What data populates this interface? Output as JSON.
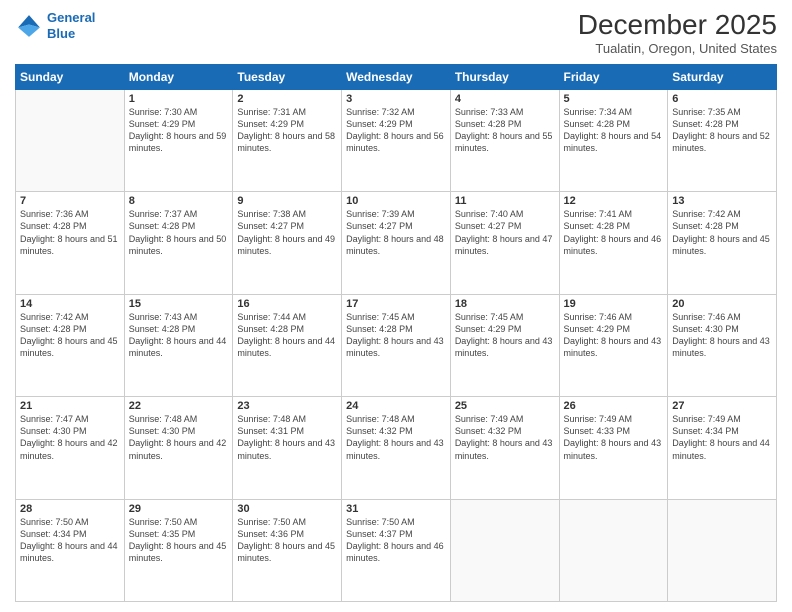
{
  "logo": {
    "line1": "General",
    "line2": "Blue"
  },
  "title": "December 2025",
  "subtitle": "Tualatin, Oregon, United States",
  "days_of_week": [
    "Sunday",
    "Monday",
    "Tuesday",
    "Wednesday",
    "Thursday",
    "Friday",
    "Saturday"
  ],
  "weeks": [
    [
      {
        "day": "",
        "sunrise": "",
        "sunset": "",
        "daylight": ""
      },
      {
        "day": "1",
        "sunrise": "7:30 AM",
        "sunset": "4:29 PM",
        "daylight": "8 hours and 59 minutes."
      },
      {
        "day": "2",
        "sunrise": "7:31 AM",
        "sunset": "4:29 PM",
        "daylight": "8 hours and 58 minutes."
      },
      {
        "day": "3",
        "sunrise": "7:32 AM",
        "sunset": "4:29 PM",
        "daylight": "8 hours and 56 minutes."
      },
      {
        "day": "4",
        "sunrise": "7:33 AM",
        "sunset": "4:28 PM",
        "daylight": "8 hours and 55 minutes."
      },
      {
        "day": "5",
        "sunrise": "7:34 AM",
        "sunset": "4:28 PM",
        "daylight": "8 hours and 54 minutes."
      },
      {
        "day": "6",
        "sunrise": "7:35 AM",
        "sunset": "4:28 PM",
        "daylight": "8 hours and 52 minutes."
      }
    ],
    [
      {
        "day": "7",
        "sunrise": "7:36 AM",
        "sunset": "4:28 PM",
        "daylight": "8 hours and 51 minutes."
      },
      {
        "day": "8",
        "sunrise": "7:37 AM",
        "sunset": "4:28 PM",
        "daylight": "8 hours and 50 minutes."
      },
      {
        "day": "9",
        "sunrise": "7:38 AM",
        "sunset": "4:27 PM",
        "daylight": "8 hours and 49 minutes."
      },
      {
        "day": "10",
        "sunrise": "7:39 AM",
        "sunset": "4:27 PM",
        "daylight": "8 hours and 48 minutes."
      },
      {
        "day": "11",
        "sunrise": "7:40 AM",
        "sunset": "4:27 PM",
        "daylight": "8 hours and 47 minutes."
      },
      {
        "day": "12",
        "sunrise": "7:41 AM",
        "sunset": "4:28 PM",
        "daylight": "8 hours and 46 minutes."
      },
      {
        "day": "13",
        "sunrise": "7:42 AM",
        "sunset": "4:28 PM",
        "daylight": "8 hours and 45 minutes."
      }
    ],
    [
      {
        "day": "14",
        "sunrise": "7:42 AM",
        "sunset": "4:28 PM",
        "daylight": "8 hours and 45 minutes."
      },
      {
        "day": "15",
        "sunrise": "7:43 AM",
        "sunset": "4:28 PM",
        "daylight": "8 hours and 44 minutes."
      },
      {
        "day": "16",
        "sunrise": "7:44 AM",
        "sunset": "4:28 PM",
        "daylight": "8 hours and 44 minutes."
      },
      {
        "day": "17",
        "sunrise": "7:45 AM",
        "sunset": "4:28 PM",
        "daylight": "8 hours and 43 minutes."
      },
      {
        "day": "18",
        "sunrise": "7:45 AM",
        "sunset": "4:29 PM",
        "daylight": "8 hours and 43 minutes."
      },
      {
        "day": "19",
        "sunrise": "7:46 AM",
        "sunset": "4:29 PM",
        "daylight": "8 hours and 43 minutes."
      },
      {
        "day": "20",
        "sunrise": "7:46 AM",
        "sunset": "4:30 PM",
        "daylight": "8 hours and 43 minutes."
      }
    ],
    [
      {
        "day": "21",
        "sunrise": "7:47 AM",
        "sunset": "4:30 PM",
        "daylight": "8 hours and 42 minutes."
      },
      {
        "day": "22",
        "sunrise": "7:48 AM",
        "sunset": "4:30 PM",
        "daylight": "8 hours and 42 minutes."
      },
      {
        "day": "23",
        "sunrise": "7:48 AM",
        "sunset": "4:31 PM",
        "daylight": "8 hours and 43 minutes."
      },
      {
        "day": "24",
        "sunrise": "7:48 AM",
        "sunset": "4:32 PM",
        "daylight": "8 hours and 43 minutes."
      },
      {
        "day": "25",
        "sunrise": "7:49 AM",
        "sunset": "4:32 PM",
        "daylight": "8 hours and 43 minutes."
      },
      {
        "day": "26",
        "sunrise": "7:49 AM",
        "sunset": "4:33 PM",
        "daylight": "8 hours and 43 minutes."
      },
      {
        "day": "27",
        "sunrise": "7:49 AM",
        "sunset": "4:34 PM",
        "daylight": "8 hours and 44 minutes."
      }
    ],
    [
      {
        "day": "28",
        "sunrise": "7:50 AM",
        "sunset": "4:34 PM",
        "daylight": "8 hours and 44 minutes."
      },
      {
        "day": "29",
        "sunrise": "7:50 AM",
        "sunset": "4:35 PM",
        "daylight": "8 hours and 45 minutes."
      },
      {
        "day": "30",
        "sunrise": "7:50 AM",
        "sunset": "4:36 PM",
        "daylight": "8 hours and 45 minutes."
      },
      {
        "day": "31",
        "sunrise": "7:50 AM",
        "sunset": "4:37 PM",
        "daylight": "8 hours and 46 minutes."
      },
      {
        "day": "",
        "sunrise": "",
        "sunset": "",
        "daylight": ""
      },
      {
        "day": "",
        "sunrise": "",
        "sunset": "",
        "daylight": ""
      },
      {
        "day": "",
        "sunrise": "",
        "sunset": "",
        "daylight": ""
      }
    ]
  ]
}
